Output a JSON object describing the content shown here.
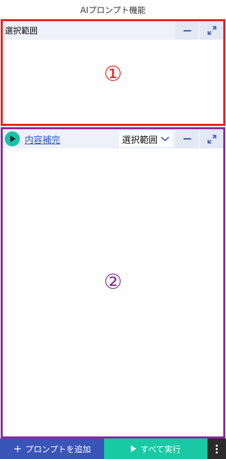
{
  "window": {
    "title": "AIプロンプト機能"
  },
  "panel_selection": {
    "label": "選択範囲",
    "marker": "①",
    "border_color": "#e8231b",
    "minimize_icon": "minus-icon",
    "expand_icon": "expand-arrows-icon"
  },
  "panel_prompt": {
    "run_icon": "play-icon",
    "prompt_name": "内容補完",
    "scope_value": "選択範囲",
    "scope_icon": "chevron-down-icon",
    "marker": "②",
    "border_color": "#8a2a9b",
    "minimize_icon": "minus-icon",
    "expand_icon": "expand-arrows-icon"
  },
  "footer": {
    "add_icon": "+",
    "add_label": "プロンプトを追加",
    "run_all_label": "すべて実行",
    "more_icon": "vertical-dots-icon",
    "colors": {
      "add": "#3a55b8",
      "run_all": "#18c9a3",
      "more": "#2b2b2b"
    }
  }
}
